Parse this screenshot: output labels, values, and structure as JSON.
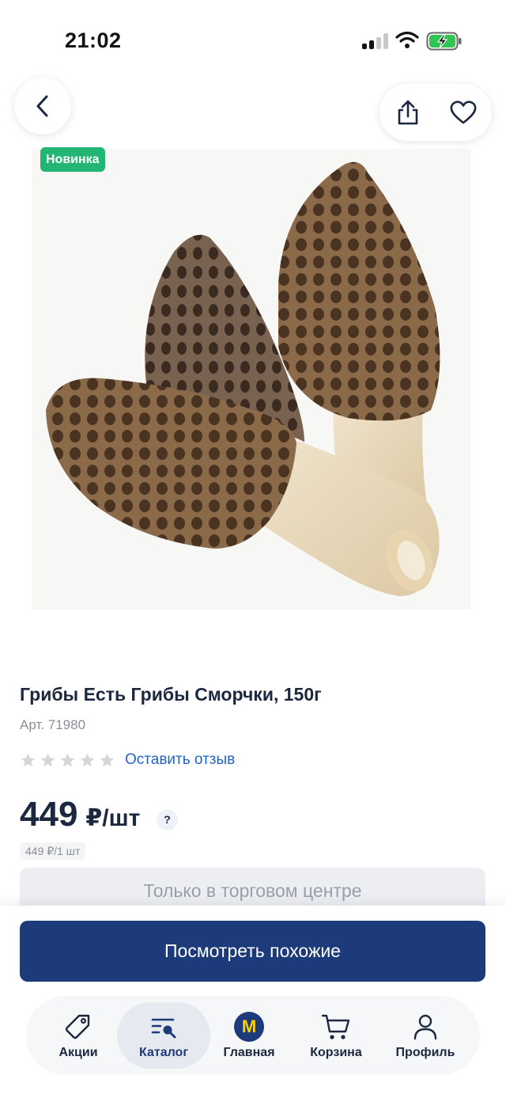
{
  "status_bar": {
    "time": "21:02",
    "icons": [
      "cellular-signal-icon",
      "wifi-icon",
      "battery-charging-icon"
    ]
  },
  "header": {
    "back_icon": "chevron-left-icon",
    "share_icon": "share-icon",
    "favorite_icon": "heart-icon"
  },
  "product": {
    "badge": "Новинка",
    "image_subject": "morel mushrooms",
    "title": "Грибы Есть Грибы Сморчки, 150г",
    "article": "Арт. 71980",
    "rating": {
      "stars_filled": 0,
      "stars_total": 5
    },
    "review_link": "Оставить отзыв",
    "price": "449",
    "price_unit": "₽/шт",
    "price_help": "?",
    "unit_price": "449 ₽/1 шт",
    "availability": "Только в торговом центре"
  },
  "actions": {
    "similar_button": "Посмотреть похожие"
  },
  "tab_bar": {
    "active": "catalog",
    "items": [
      {
        "id": "promo",
        "label": "Акции",
        "icon": "tag-icon"
      },
      {
        "id": "catalog",
        "label": "Каталог",
        "icon": "catalog-search-icon"
      },
      {
        "id": "home",
        "label": "Главная",
        "icon": "store-logo-icon",
        "logo_letter": "М"
      },
      {
        "id": "cart",
        "label": "Корзина",
        "icon": "cart-icon"
      },
      {
        "id": "profile",
        "label": "Профиль",
        "icon": "user-icon"
      }
    ]
  },
  "colors": {
    "primary": "#1d3a7a",
    "badge_green": "#22b573",
    "link_blue": "#2063c7",
    "logo_yellow": "#ffd000"
  }
}
